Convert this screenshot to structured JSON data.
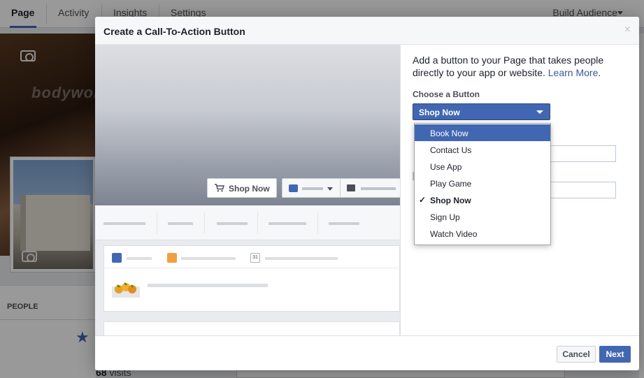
{
  "background": {
    "tabs": [
      "Page",
      "Activity",
      "Insights",
      "Settings"
    ],
    "build_audience": "Build Audience",
    "cover_text": "bodywork",
    "people_label": "PEOPLE",
    "visits_count": "68",
    "visits_label": "visits"
  },
  "modal": {
    "title": "Create a Call-To-Action Button",
    "close_glyph": "×",
    "preview": {
      "cta_button_label": "Shop Now",
      "calendar_day": "31"
    },
    "pane": {
      "description": "Add a button to your Page that takes people directly to your app or website.",
      "learn_more": "Learn More",
      "description_end": ".",
      "choose_label": "Choose a Button",
      "selected_value": "Shop Now",
      "options": [
        {
          "label": "Book Now",
          "state": "hover"
        },
        {
          "label": "Contact Us",
          "state": ""
        },
        {
          "label": "Use App",
          "state": ""
        },
        {
          "label": "Play Game",
          "state": ""
        },
        {
          "label": "Shop Now",
          "state": "selected"
        },
        {
          "label": "Sign Up",
          "state": ""
        },
        {
          "label": "Watch Video",
          "state": ""
        }
      ],
      "check_glyph": "✓"
    },
    "footer": {
      "cancel_label": "Cancel",
      "next_label": "Next"
    }
  },
  "colors": {
    "accent": "#4267b2",
    "header_bg": "#f6f7f9"
  }
}
